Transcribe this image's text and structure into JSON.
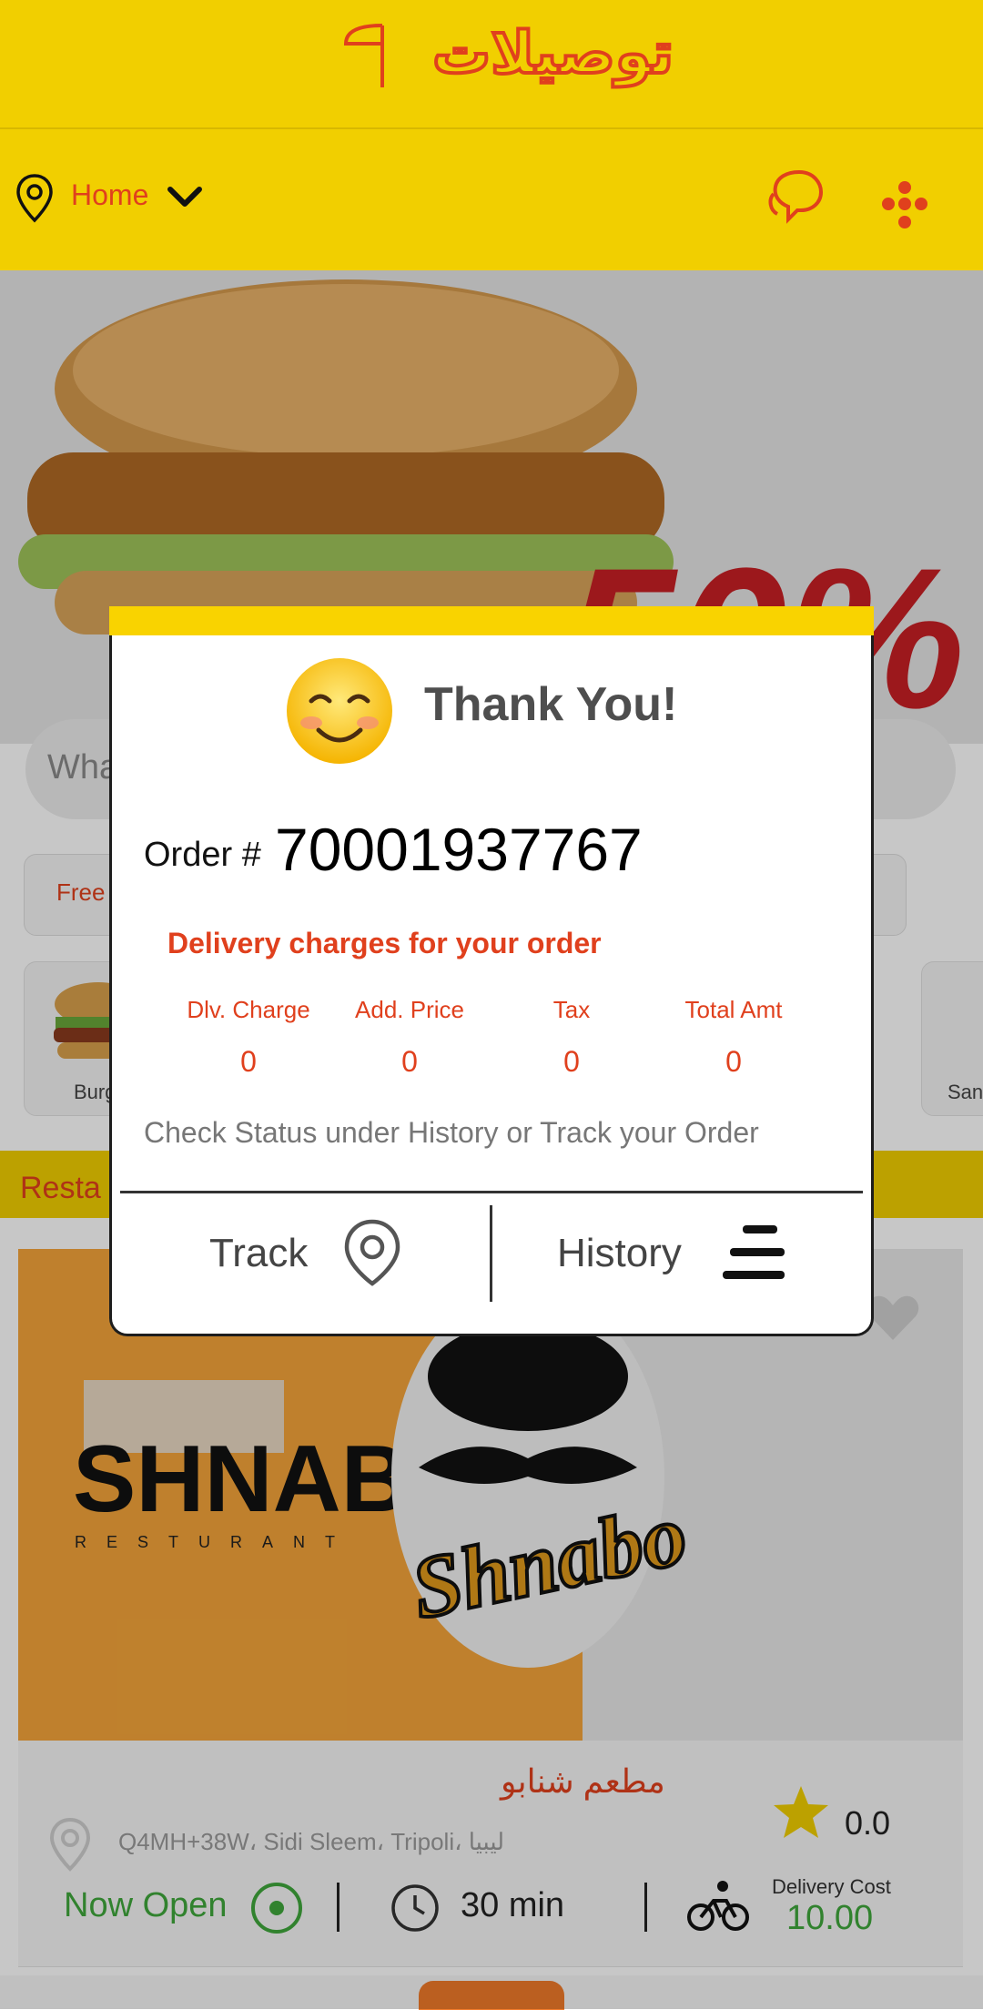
{
  "header": {
    "logo_text": "توصيلات",
    "location_label": "Home"
  },
  "background": {
    "banner_badge": "50%",
    "search_placeholder": "Wha",
    "free_chip": "Free",
    "categories": [
      {
        "label": "Burg"
      },
      {
        "label": "Sand"
      }
    ],
    "section_title": "Resta",
    "restaurant": {
      "brand_logo_text": "SHNABO",
      "brand_logo_sub": "RESTURANT",
      "mascot_text": "Shnabo",
      "name": "مطعم شنابو",
      "address": "Q4MH+38W، Sidi Sleem، Tripoli، ليبيا",
      "rating": "0.0",
      "status": "Now Open",
      "delivery_time": "30 min",
      "delivery_cost_label": "Delivery Cost",
      "delivery_cost_value": "10.00"
    }
  },
  "dialog": {
    "title": "Thank You!",
    "order_prefix": "Order #",
    "order_number": "70001937767",
    "charges_title": "Delivery charges for your order",
    "fees": [
      {
        "label": "Dlv. Charge",
        "value": "0"
      },
      {
        "label": "Add. Price",
        "value": "0"
      },
      {
        "label": "Tax",
        "value": "0"
      },
      {
        "label": "Total Amt",
        "value": "0"
      }
    ],
    "status_text": "Check Status under History or Track your Order",
    "track_label": "Track",
    "history_label": "History"
  },
  "colors": {
    "brand_yellow": "#f1cf00",
    "accent_red": "#e0401d",
    "open_green": "#3fa73c"
  }
}
